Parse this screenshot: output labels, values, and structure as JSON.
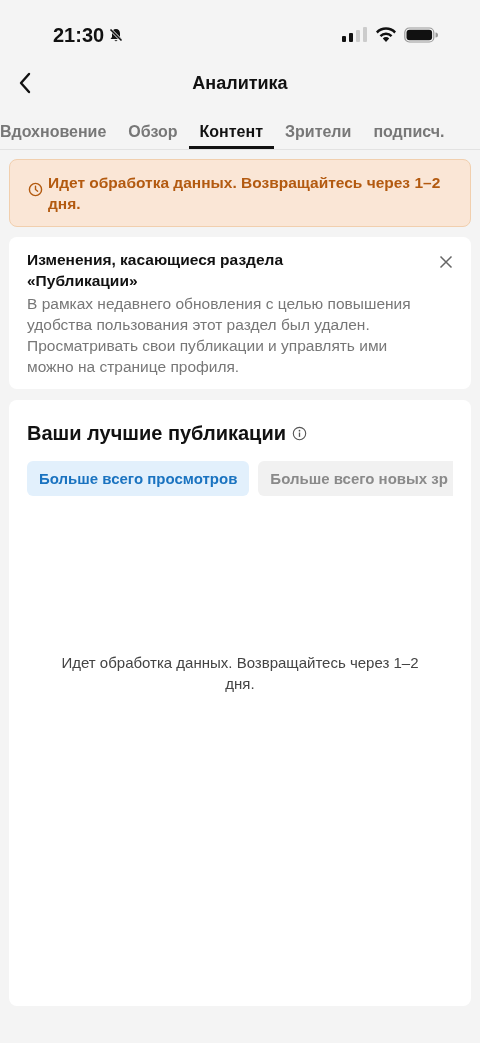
{
  "status_bar": {
    "time": "21:30"
  },
  "header": {
    "title": "Аналитика"
  },
  "tabs": [
    {
      "label": "Вдохновение",
      "selected": false
    },
    {
      "label": "Обзор",
      "selected": false
    },
    {
      "label": "Контент",
      "selected": true
    },
    {
      "label": "Зрители",
      "selected": false
    },
    {
      "label": "подписч.",
      "selected": false
    }
  ],
  "processing_banner": {
    "text": "Идет обработка данных. Возвращайтесь через 1–2 дня."
  },
  "notice": {
    "title": "Изменения, касающиеся раздела «Публикации»",
    "body": "В рамках недавнего обновления с целью повышения удобства пользования этот раздел был удален. Просматривать свои публикации и управлять ими можно на странице профиля."
  },
  "top_posts": {
    "title": "Ваши лучшие публикации",
    "filters": [
      {
        "label": "Больше всего просмотров",
        "selected": true
      },
      {
        "label": "Больше всего новых зр",
        "selected": false
      }
    ],
    "empty_message": "Идет обработка данных. Возвращайтесь через 1–2 дня."
  }
}
